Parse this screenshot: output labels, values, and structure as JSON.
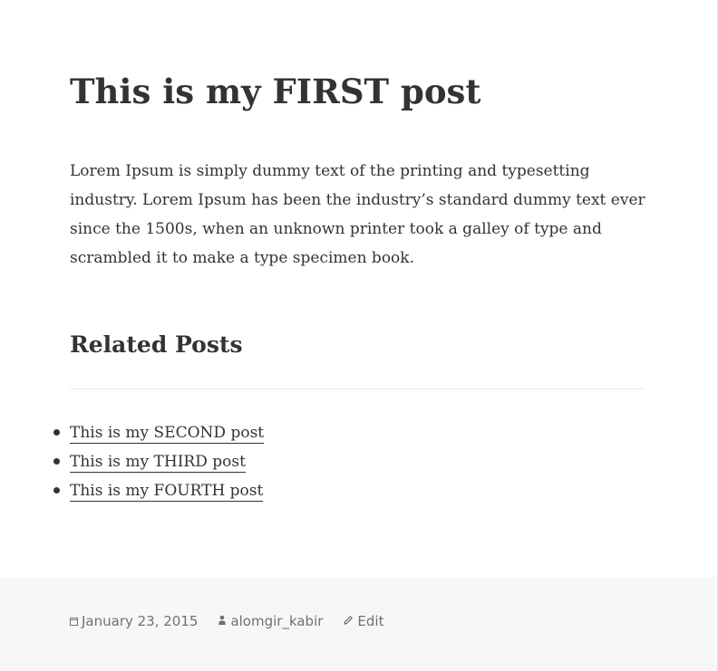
{
  "post": {
    "title": "This is my FIRST post",
    "body": "Lorem Ipsum is simply dummy text of the printing and typesetting industry. Lorem Ipsum has been the industry’s standard dummy text ever since the 1500s, when an unknown printer took a galley of type and scrambled it to make a type specimen book."
  },
  "related": {
    "heading": "Related Posts",
    "items": [
      {
        "label": "This is my SECOND post"
      },
      {
        "label": "This is my THIRD post"
      },
      {
        "label": "This is my FOURTH post"
      }
    ]
  },
  "footer": {
    "date": "January 23, 2015",
    "author": "alomgir_kabir",
    "edit_label": "Edit",
    "icons": {
      "date": "calendar-icon",
      "author": "person-icon",
      "edit": "pencil-icon"
    }
  },
  "colors": {
    "text": "#333333",
    "meta_text": "#707070",
    "footer_bg": "#f7f7f7",
    "divider": "#eaeaea"
  }
}
